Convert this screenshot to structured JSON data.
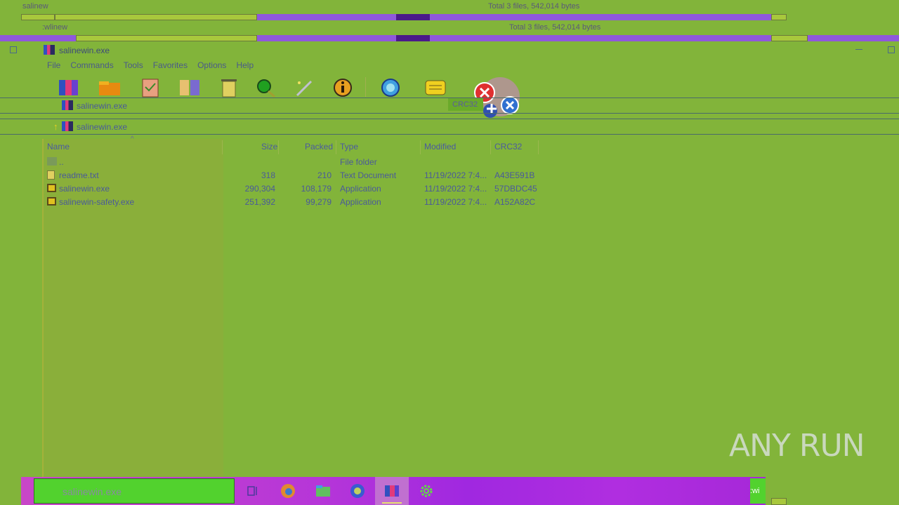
{
  "background_strips": {
    "row1_title": "salinew",
    "row1_status": "Total 3 files, 542,014 bytes",
    "row2_title": ":wlinew",
    "row2_status": "Total 3 files, 542,014 bytes"
  },
  "window": {
    "title": "salinewin.exe",
    "menu": [
      "File",
      "Commands",
      "Tools",
      "Favorites",
      "Options",
      "Help"
    ],
    "toolbar_icons": [
      "add-icon",
      "extract-icon",
      "test-icon",
      "view-icon",
      "delete-icon",
      "find-icon",
      "wizard-icon",
      "info-icon",
      "virusscan-icon",
      "comment-icon",
      "protect-icon"
    ],
    "address_rows": [
      "salinewin.exe",
      "salinewin.exe"
    ],
    "tooltip": "CRC32"
  },
  "file_list": {
    "columns": [
      "Name",
      "Size",
      "Packed",
      "Type",
      "Modified",
      "CRC32"
    ],
    "rows": [
      {
        "name": "..",
        "size": "",
        "packed": "",
        "type": "File folder",
        "modified": "",
        "crc": "",
        "icon": "folder-up-icon"
      },
      {
        "name": "readme.txt",
        "size": "318",
        "packed": "210",
        "type": "Text Document",
        "modified": "11/19/2022 7:4...",
        "crc": "A43E591B",
        "icon": "text-file-icon"
      },
      {
        "name": "salinewin.exe",
        "size": "290,304",
        "packed": "108,179",
        "type": "Application",
        "modified": "11/19/2022 7:4...",
        "crc": "57DBDC45",
        "icon": "exe-file-icon"
      },
      {
        "name": "salinewin-safety.exe",
        "size": "251,392",
        "packed": "99,279",
        "type": "Application",
        "modified": "11/19/2022 7:4...",
        "crc": "A152A82C",
        "icon": "exe-file-icon"
      }
    ]
  },
  "taskbar": {
    "search_text": "salinewin.exe",
    "left_stub": "sal",
    "right_stub": ":wi",
    "icons": [
      "task-view-icon",
      "edge-icon",
      "file-explorer-icon",
      "firefox-icon",
      "winrar-icon",
      "settings-icon"
    ]
  },
  "watermark": "ANY RUN",
  "colors": {
    "bg": "#82b43a",
    "accent_purple": "#8f58dc",
    "taskbar": "#b636d8",
    "search": "#52d22e"
  }
}
